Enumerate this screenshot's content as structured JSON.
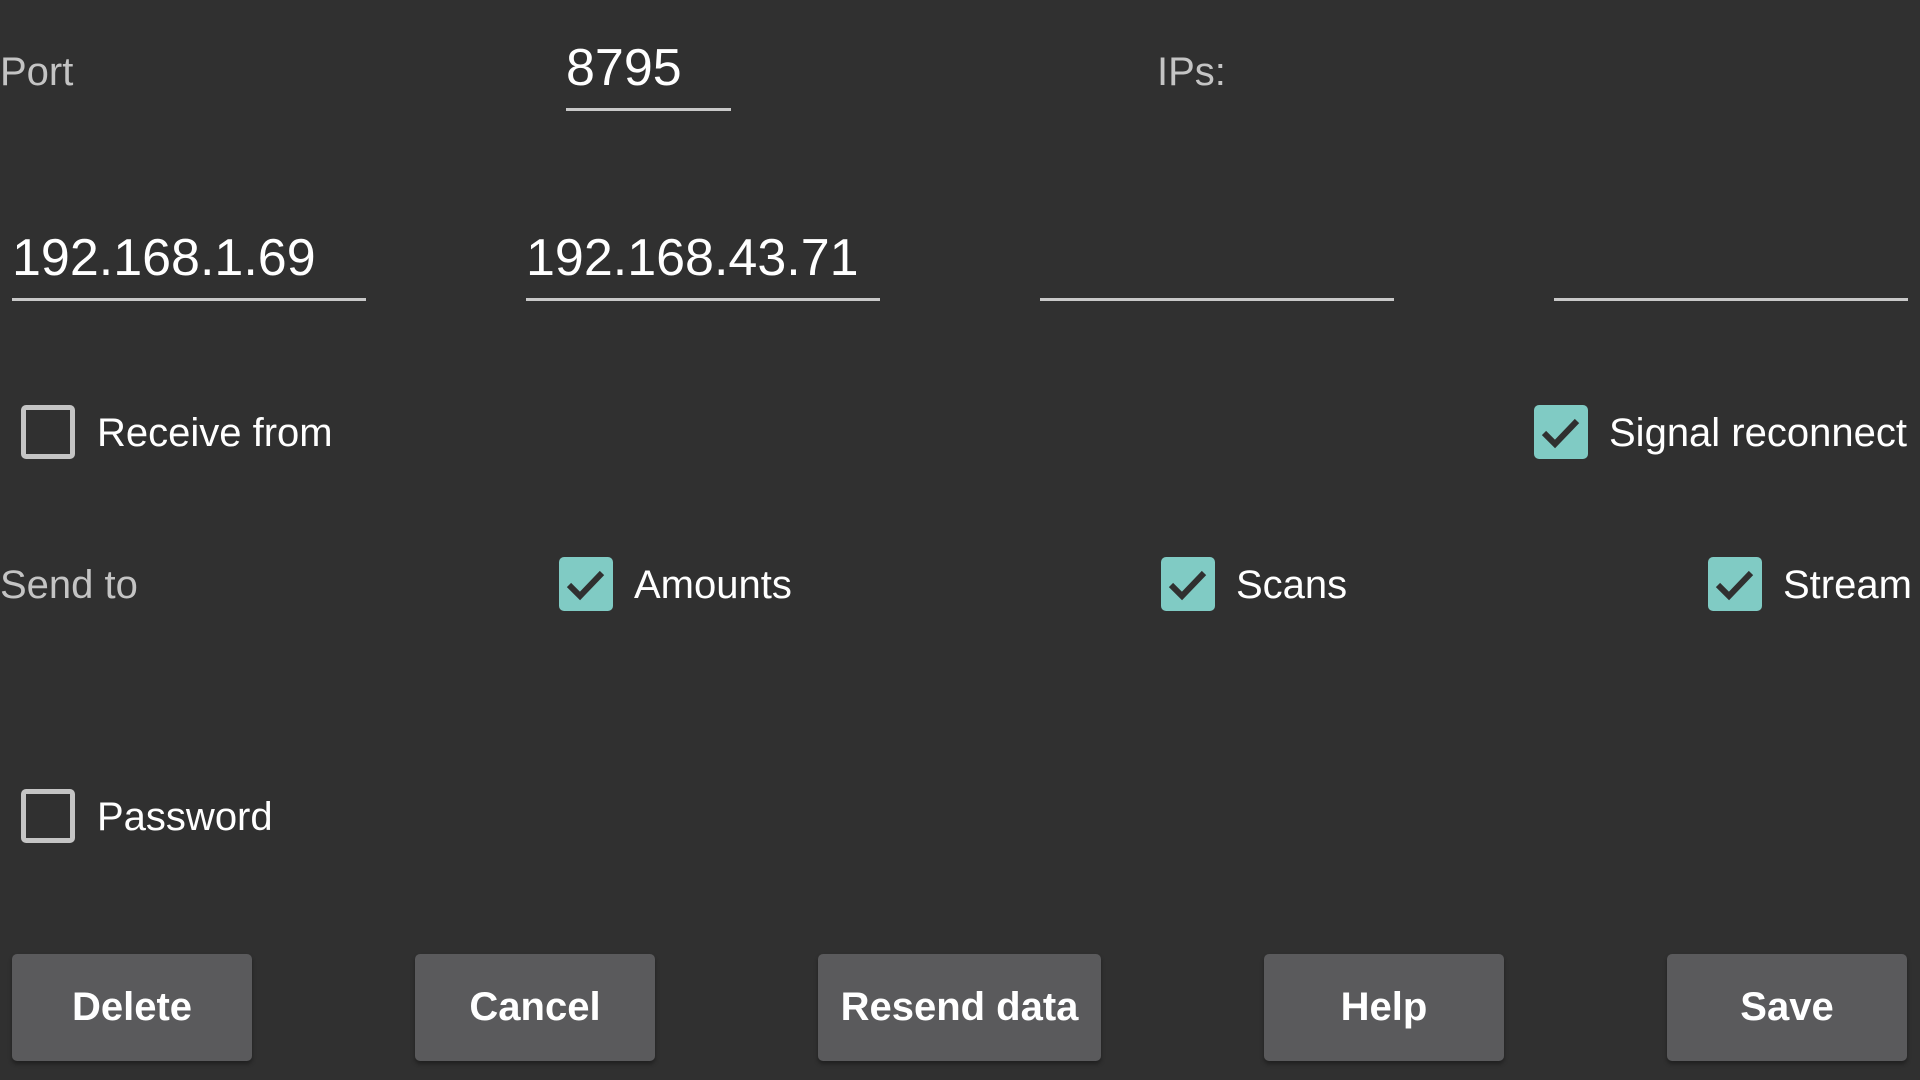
{
  "port": {
    "label": "Port",
    "value": "8795"
  },
  "ips": {
    "label": "IPs:",
    "fields": [
      {
        "value": "192.168.1.69",
        "placeholder": ""
      },
      {
        "value": "192.168.43.71",
        "placeholder": ""
      },
      {
        "value": "",
        "placeholder": ""
      },
      {
        "value": "",
        "placeholder": ""
      }
    ]
  },
  "options": {
    "receive_from": {
      "label": "Receive from",
      "checked": false
    },
    "signal_reconnect": {
      "label": "Signal reconnect",
      "checked": true
    },
    "password": {
      "label": "Password",
      "checked": false
    }
  },
  "send_to": {
    "label": "Send to",
    "items": [
      {
        "label": "Amounts",
        "checked": true
      },
      {
        "label": "Scans",
        "checked": true
      },
      {
        "label": "Stream",
        "checked": true
      }
    ]
  },
  "buttons": {
    "delete": "Delete",
    "cancel": "Cancel",
    "resend": "Resend data",
    "help": "Help",
    "save": "Save"
  },
  "colors": {
    "background": "#303030",
    "accent": "#80cbc4",
    "button": "#5a5a5c"
  }
}
